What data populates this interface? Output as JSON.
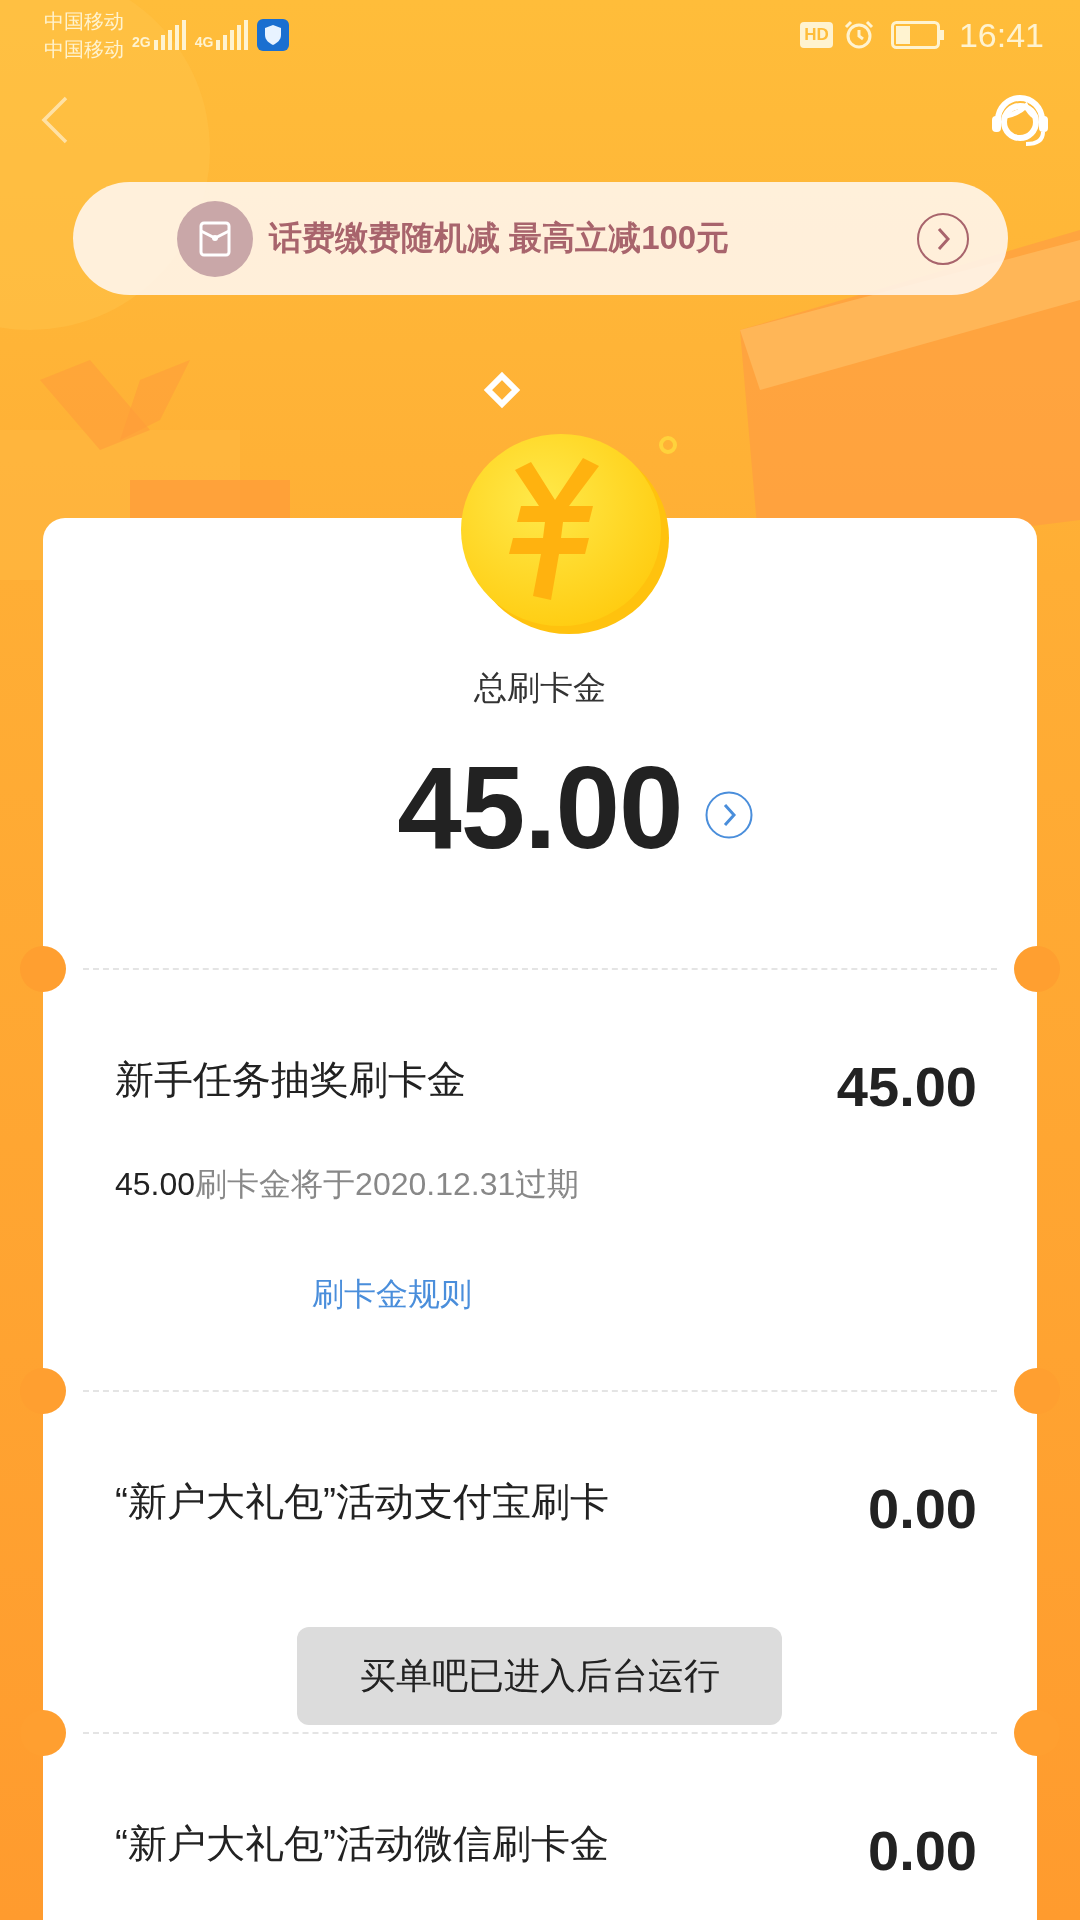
{
  "status_bar": {
    "carriers": [
      "中国移动",
      "中国移动"
    ],
    "networks": [
      "2G",
      "4G"
    ],
    "hd_label": "HD",
    "time": "16:41"
  },
  "promo_banner": {
    "text": "话费缴费随机减 最高立减100元"
  },
  "summary": {
    "label": "总刷卡金",
    "amount": "45.00"
  },
  "items": [
    {
      "title": "新手任务抽奖刷卡金",
      "amount": "45.00",
      "expiry": {
        "amount": "45.00",
        "text": "刷卡金将于2020.12.31过期"
      },
      "rule_link": "刷卡金规则"
    },
    {
      "title": "“新户大礼包”活动支付宝刷卡",
      "amount": "0.00"
    },
    {
      "title": "“新户大礼包”活动微信刷卡金",
      "amount": "0.00"
    }
  ],
  "toast": {
    "text": "买单吧已进入后台运行"
  }
}
